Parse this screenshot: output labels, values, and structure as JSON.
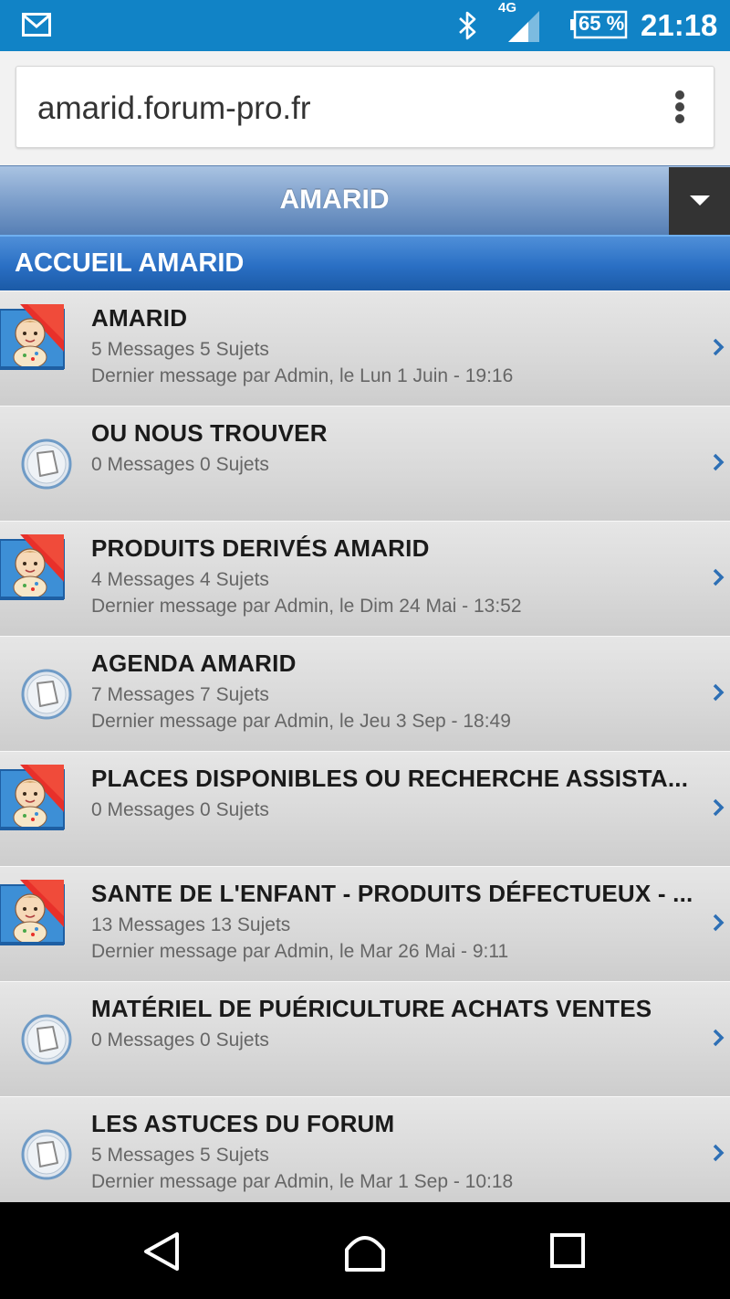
{
  "status_bar": {
    "network": "4G",
    "battery": "65 %",
    "time": "21:18",
    "icons": [
      "mail-icon",
      "bluetooth-icon",
      "signal-icon",
      "battery-icon"
    ]
  },
  "browser": {
    "url": "amarid.forum-pro.fr",
    "menu_icon": "overflow-menu-icon"
  },
  "header": {
    "title": "AMARID",
    "dropdown_icon": "caret-down-icon"
  },
  "section": {
    "title": "ACCUEIL AMARID"
  },
  "colors": {
    "status_bar": "#1183c6",
    "header": "#7d9fcb",
    "section": "#2a6fc4",
    "chevron": "#2d6fb5"
  },
  "forums": [
    {
      "icon": "baby-forum-icon",
      "title": "AMARID",
      "stats": "5 Messages 5 Sujets",
      "last": "Dernier message par Admin, le Lun 1 Juin - 19:16"
    },
    {
      "icon": "no-new-posts-icon",
      "title": "OU NOUS TROUVER",
      "stats": "0 Messages 0 Sujets",
      "last": ""
    },
    {
      "icon": "baby-forum-icon",
      "title": "PRODUITS DERIVÉS AMARID",
      "stats": "4 Messages 4 Sujets",
      "last": "Dernier message par Admin, le Dim 24 Mai - 13:52"
    },
    {
      "icon": "no-new-posts-icon",
      "title": "AGENDA AMARID",
      "stats": "7 Messages 7 Sujets",
      "last": "Dernier message par Admin, le Jeu 3 Sep - 18:49"
    },
    {
      "icon": "baby-forum-icon",
      "title": "PLACES DISPONIBLES OU RECHERCHE ASSISTA...",
      "stats": "0 Messages 0 Sujets",
      "last": ""
    },
    {
      "icon": "baby-forum-icon",
      "title": "SANTE DE L'ENFANT - PRODUITS DÉFECTUEUX - ...",
      "stats": "13 Messages 13 Sujets",
      "last": "Dernier message par Admin, le Mar 26 Mai - 9:11"
    },
    {
      "icon": "no-new-posts-icon",
      "title": "MATÉRIEL DE PUÉRICULTURE ACHATS VENTES",
      "stats": "0 Messages 0 Sujets",
      "last": ""
    },
    {
      "icon": "no-new-posts-icon",
      "title": "LES ASTUCES DU FORUM",
      "stats": "5 Messages 5 Sujets",
      "last": "Dernier message par Admin, le Mar 1 Sep - 10:18"
    }
  ],
  "nav": {
    "icons": [
      "back-icon",
      "home-icon",
      "recents-icon"
    ]
  }
}
